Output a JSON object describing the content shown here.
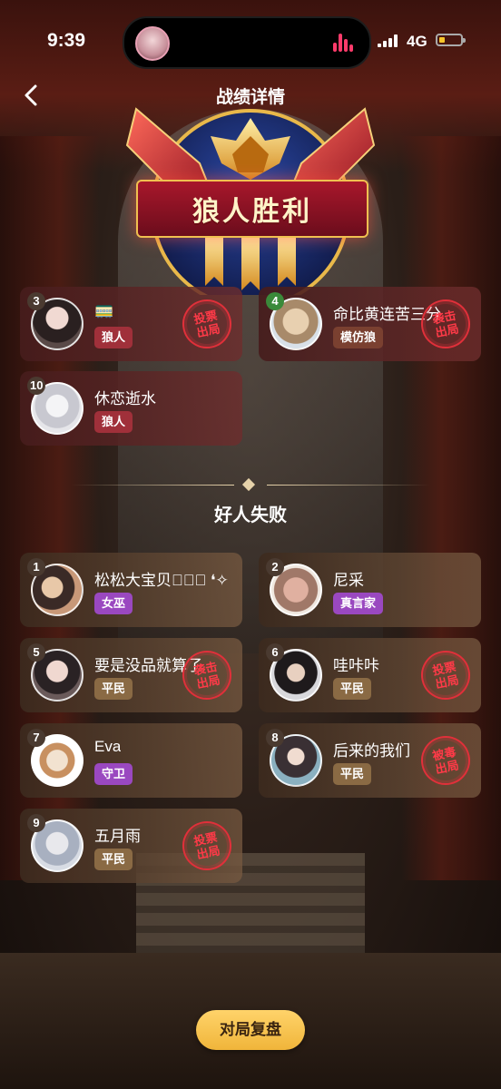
{
  "status_bar": {
    "time": "9:39",
    "network": "4G"
  },
  "header": {
    "title": "战绩详情"
  },
  "emblem": {
    "text": "狼人胜利"
  },
  "wolf_team": [
    {
      "seat": "3",
      "name": "🚃",
      "role": "狼人",
      "role_color": "#a0303a",
      "stamp": "投票出局"
    },
    {
      "seat": "4",
      "name": "命比黄连苦三分",
      "role": "模仿狼",
      "role_color": "#7a4030",
      "stamp": "袭击出局"
    },
    {
      "seat": "10",
      "name": "休恋逝水",
      "role": "狼人",
      "role_color": "#a0303a",
      "stamp": ""
    }
  ],
  "good_section": {
    "title": "好人失败"
  },
  "good_team": [
    {
      "seat": "1",
      "name": "松松大宝贝❛⃘⃘ ❛✧",
      "role": "女巫",
      "role_color": "#9a48c0",
      "stamp": ""
    },
    {
      "seat": "2",
      "name": "尼采",
      "role": "真言家",
      "role_color": "#9a48c0",
      "stamp": ""
    },
    {
      "seat": "5",
      "name": "要是没品就算了",
      "role": "平民",
      "role_color": "#8a6a44",
      "stamp": "袭击出局"
    },
    {
      "seat": "6",
      "name": "哇咔咔",
      "role": "平民",
      "role_color": "#8a6a44",
      "stamp": "投票出局"
    },
    {
      "seat": "7",
      "name": "Eva",
      "role": "守卫",
      "role_color": "#9a48c0",
      "stamp": ""
    },
    {
      "seat": "8",
      "name": "后来的我们",
      "role": "平民",
      "role_color": "#8a6a44",
      "stamp": "被毒出局"
    },
    {
      "seat": "9",
      "name": "五月雨",
      "role": "平民",
      "role_color": "#8a6a44",
      "stamp": "投票出局"
    }
  ],
  "footer": {
    "replay_label": "对局复盘"
  }
}
